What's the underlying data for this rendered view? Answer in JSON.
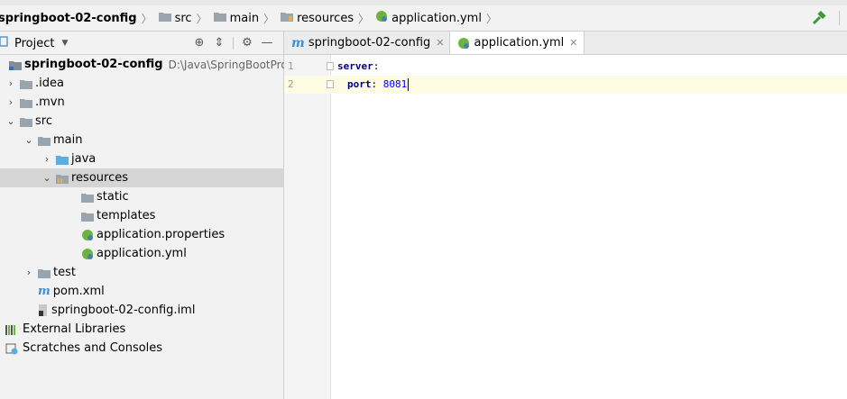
{
  "breadcrumb": {
    "items": [
      "springboot-02-config",
      "src",
      "main",
      "resources",
      "application.yml"
    ]
  },
  "project_panel": {
    "title": "Project",
    "tree": {
      "root": {
        "label": "springboot-02-config",
        "path": "D:\\Java\\SpringBootProject"
      },
      "idea": ".idea",
      "mvn": ".mvn",
      "src": "src",
      "main": "main",
      "java": "java",
      "resources": "resources",
      "static": "static",
      "templates": "templates",
      "app_properties": "application.properties",
      "app_yml": "application.yml",
      "test": "test",
      "pom": "pom.xml",
      "iml": "springboot-02-config.iml",
      "external_libraries": "External Libraries",
      "scratches": "Scratches and Consoles"
    }
  },
  "editor": {
    "tabs": [
      {
        "label": "springboot-02-config",
        "active": false
      },
      {
        "label": "application.yml",
        "active": true
      }
    ],
    "lines": [
      {
        "number": "1",
        "key": "server",
        "colon": ":",
        "value": ""
      },
      {
        "number": "2",
        "key": "port",
        "colon": ":",
        "value": "8081"
      }
    ]
  },
  "colors": {
    "spring_green": "#6db33f",
    "folder_gray": "#9aa4ad",
    "folder_blue": "#5aaee0",
    "maven_blue": "#3d8fd6",
    "yaml_key": "#000080",
    "yaml_number": "#0000ff",
    "hammer_green": "#3a9a3a"
  },
  "icons": {
    "folder": "folder-icon",
    "spring_file": "spring-leaf-icon",
    "maven": "maven-m-icon",
    "libraries": "library-bars-icon",
    "scratches": "scratches-icon",
    "build": "hammer-icon",
    "locate": "crosshair-icon",
    "collapse": "collapse-icon",
    "settings": "gear-icon",
    "hide": "minus-icon"
  }
}
